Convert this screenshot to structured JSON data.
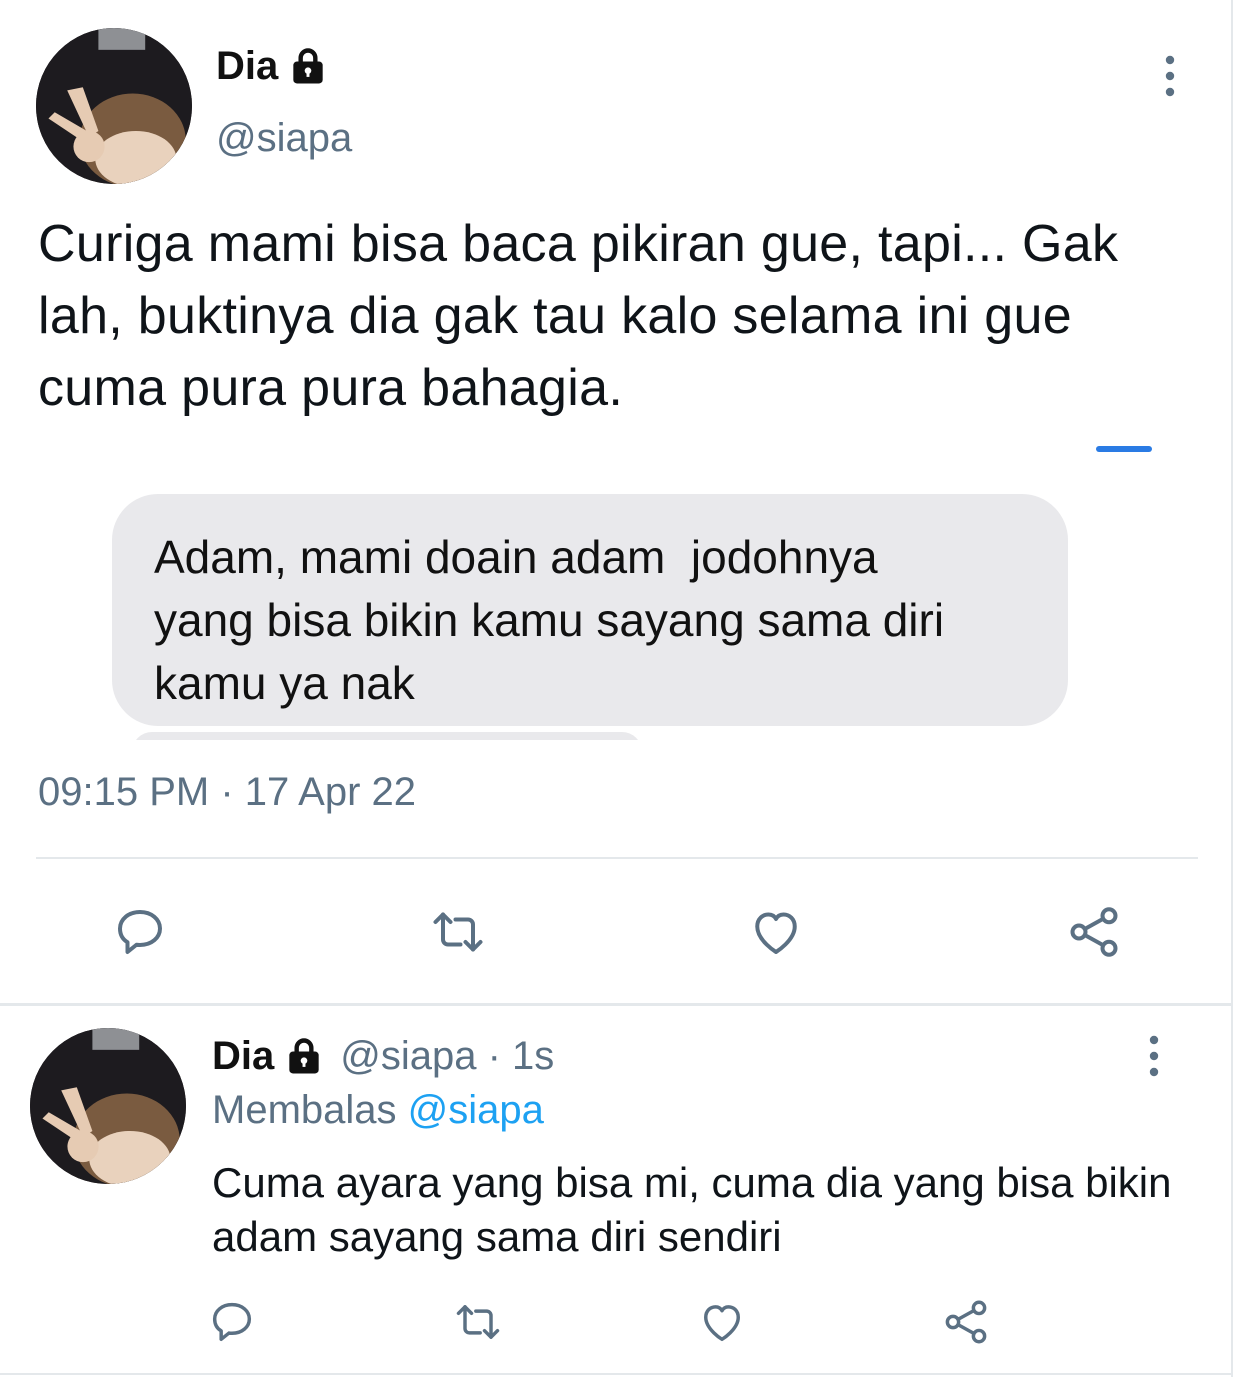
{
  "main_tweet": {
    "display_name": "Dia",
    "handle": "@siapa",
    "text": "Curiga mami bisa baca pikiran gue, tapi... Gak lah, buktinya dia gak tau kalo selama ini gue cuma pura pura bahagia.",
    "media": {
      "bubble_text": "Adam, mami doain adam  jodohnya\nyang bisa bikin kamu sayang sama diri\nkamu ya nak"
    },
    "timestamp": "09:15 PM · 17 Apr 22"
  },
  "reply_tweet": {
    "display_name": "Dia",
    "meta": "@siapa · 1s",
    "replying_label": "Membalas",
    "replying_mention": "@siapa",
    "text": "Cuma ayara yang bisa mi, cuma dia yang bisa bikin adam sayang sama diri sendiri"
  },
  "icons": {
    "lock": "lock-icon",
    "more": "more-vertical-icon",
    "reply": "reply-icon",
    "retweet": "retweet-icon",
    "like": "heart-icon",
    "share": "share-icon"
  },
  "colors": {
    "secondary_text": "#5b7083",
    "mention": "#1da1f2",
    "icon": "#5b7083",
    "divider": "#e4e8eb"
  }
}
